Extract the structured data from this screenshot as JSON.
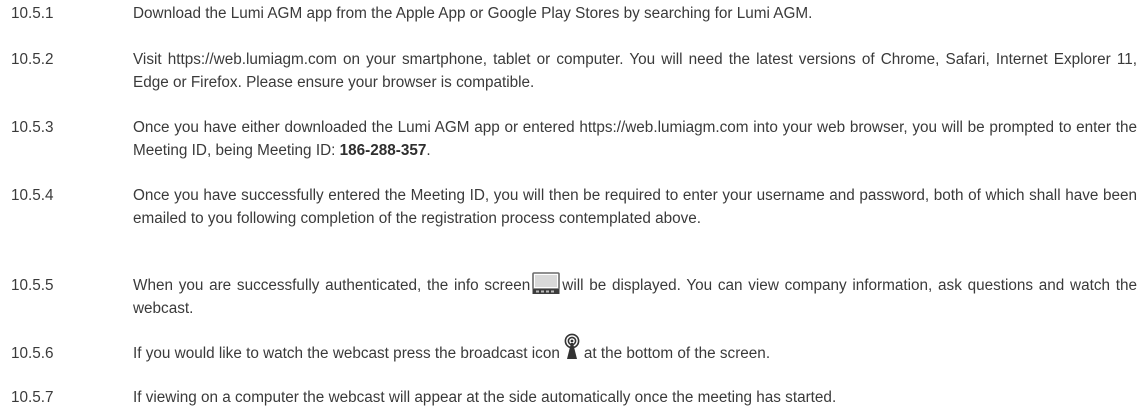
{
  "clauses": [
    {
      "number": "10.5.1",
      "text": "Download the Lumi AGM app from the Apple App or Google Play Stores by searching for Lumi AGM."
    },
    {
      "number": "10.5.2",
      "text": "Visit https://web.lumiagm.com on your smartphone, tablet or computer. You will need the latest versions of Chrome, Safari, Internet Explorer 11, Edge or Firefox. Please ensure your browser is compatible."
    },
    {
      "number": "10.5.3",
      "text_before": "Once you have either downloaded the Lumi AGM app or entered https://web.lumiagm.com into your web browser, you will be prompted to enter the Meeting ID, being Meeting ID: ",
      "meeting_id": "186-288-357",
      "text_after": "."
    },
    {
      "number": "10.5.4",
      "text": "Once you have successfully entered the Meeting ID, you will then be required to enter your username and password, both of which shall have been emailed to you following completion of the registration process contemplated above."
    },
    {
      "number": "10.5.5",
      "text_before": "When you are successfully authenticated, the info screen",
      "icon": "info-screen-icon",
      "text_after": "will be displayed. You can view company information, ask questions and watch the webcast."
    },
    {
      "number": "10.5.6",
      "text_before": "If you would like to watch the webcast press the broadcast icon",
      "icon": "broadcast-icon",
      "text_after": "at the bottom of the screen."
    },
    {
      "number": "10.5.7",
      "text": "If viewing on a computer the webcast will appear at the side automatically once the meeting has started."
    }
  ]
}
